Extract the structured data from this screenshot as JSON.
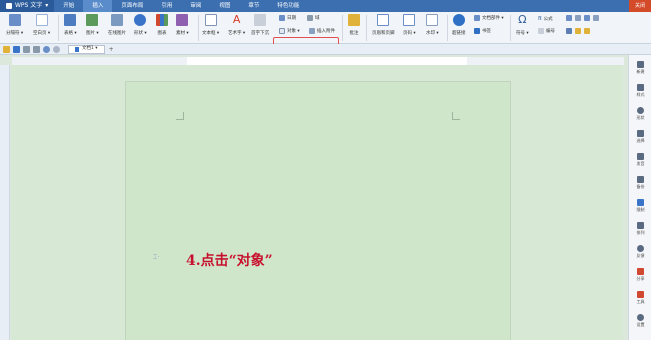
{
  "app": {
    "name": "WPS 文字",
    "close_label": "关闭"
  },
  "menu": {
    "tabs": [
      "开始",
      "插入",
      "页面布局",
      "引用",
      "审阅",
      "视图",
      "章节",
      "特色功能"
    ],
    "active_index": 1
  },
  "ribbon": {
    "buttons": [
      {
        "label": "分隔符 ▾",
        "icon": "page-break-icon",
        "color": "#6a8fc8"
      },
      {
        "label": "空白页 ▾",
        "icon": "blank-page-icon",
        "color": "#9bb3d6"
      },
      {
        "label": "表格 ▾",
        "icon": "table-icon",
        "color": "#4d7cc0"
      },
      {
        "label": "图片 ▾",
        "icon": "picture-icon",
        "color": "#5b9a5b"
      },
      {
        "label": "在线图片",
        "icon": "online-picture-icon",
        "color": "#7a9ac0"
      },
      {
        "label": "形状 ▾",
        "icon": "shapes-icon",
        "color": "#3a74c8"
      },
      {
        "label": "图表",
        "icon": "chart-icon",
        "color": "#d0482f"
      },
      {
        "label": "素材 ▾",
        "icon": "material-icon",
        "color": "#9060b0"
      },
      {
        "label": "文本框 ▾",
        "icon": "textbox-icon",
        "color": "#7f95b3"
      },
      {
        "label": "艺术字 ▾",
        "icon": "wordart-icon",
        "color": "#d83b2a"
      },
      {
        "label": "首字下沉",
        "icon": "dropcap-icon",
        "color": "#555555"
      },
      {
        "label": "批注",
        "icon": "comment-icon",
        "color": "#e0b23a"
      },
      {
        "label": "页眉和页脚",
        "icon": "header-footer-icon",
        "color": "#6a8fc8"
      },
      {
        "label": "页码 ▾",
        "icon": "page-number-icon",
        "color": "#6a8fc8"
      },
      {
        "label": "水印 ▾",
        "icon": "watermark-icon",
        "color": "#8aa0c0"
      },
      {
        "label": "超链接",
        "icon": "hyperlink-icon",
        "color": "#2f6fc4"
      },
      {
        "label": "符号 ▾",
        "icon": "symbol-icon",
        "color": "#2f5e9c"
      }
    ],
    "small_buttons": [
      {
        "label": "日期",
        "icon": "date-icon"
      },
      {
        "label": "域",
        "icon": "field-icon"
      },
      {
        "label": "对象 ▾",
        "icon": "object-icon"
      },
      {
        "label": "插入附件",
        "icon": "attachment-icon"
      },
      {
        "label": "文档部件 ▾",
        "icon": "doc-parts-icon"
      },
      {
        "label": "书签",
        "icon": "bookmark-icon"
      },
      {
        "label": "公式",
        "icon": "formula-icon"
      },
      {
        "label": "编号",
        "icon": "numbering-icon"
      }
    ]
  },
  "document": {
    "tab_label": "文档1 ▾",
    "new_tab": "+"
  },
  "page": {
    "instruction_text": "4.点击“对象”",
    "instruction_color": "#c8102e"
  },
  "sidebar": {
    "items": [
      "新建",
      "样式",
      "形状",
      "选择",
      "发音",
      "备份",
      "限制",
      "排列",
      "反馈",
      "分享",
      "工具",
      "设置"
    ]
  }
}
